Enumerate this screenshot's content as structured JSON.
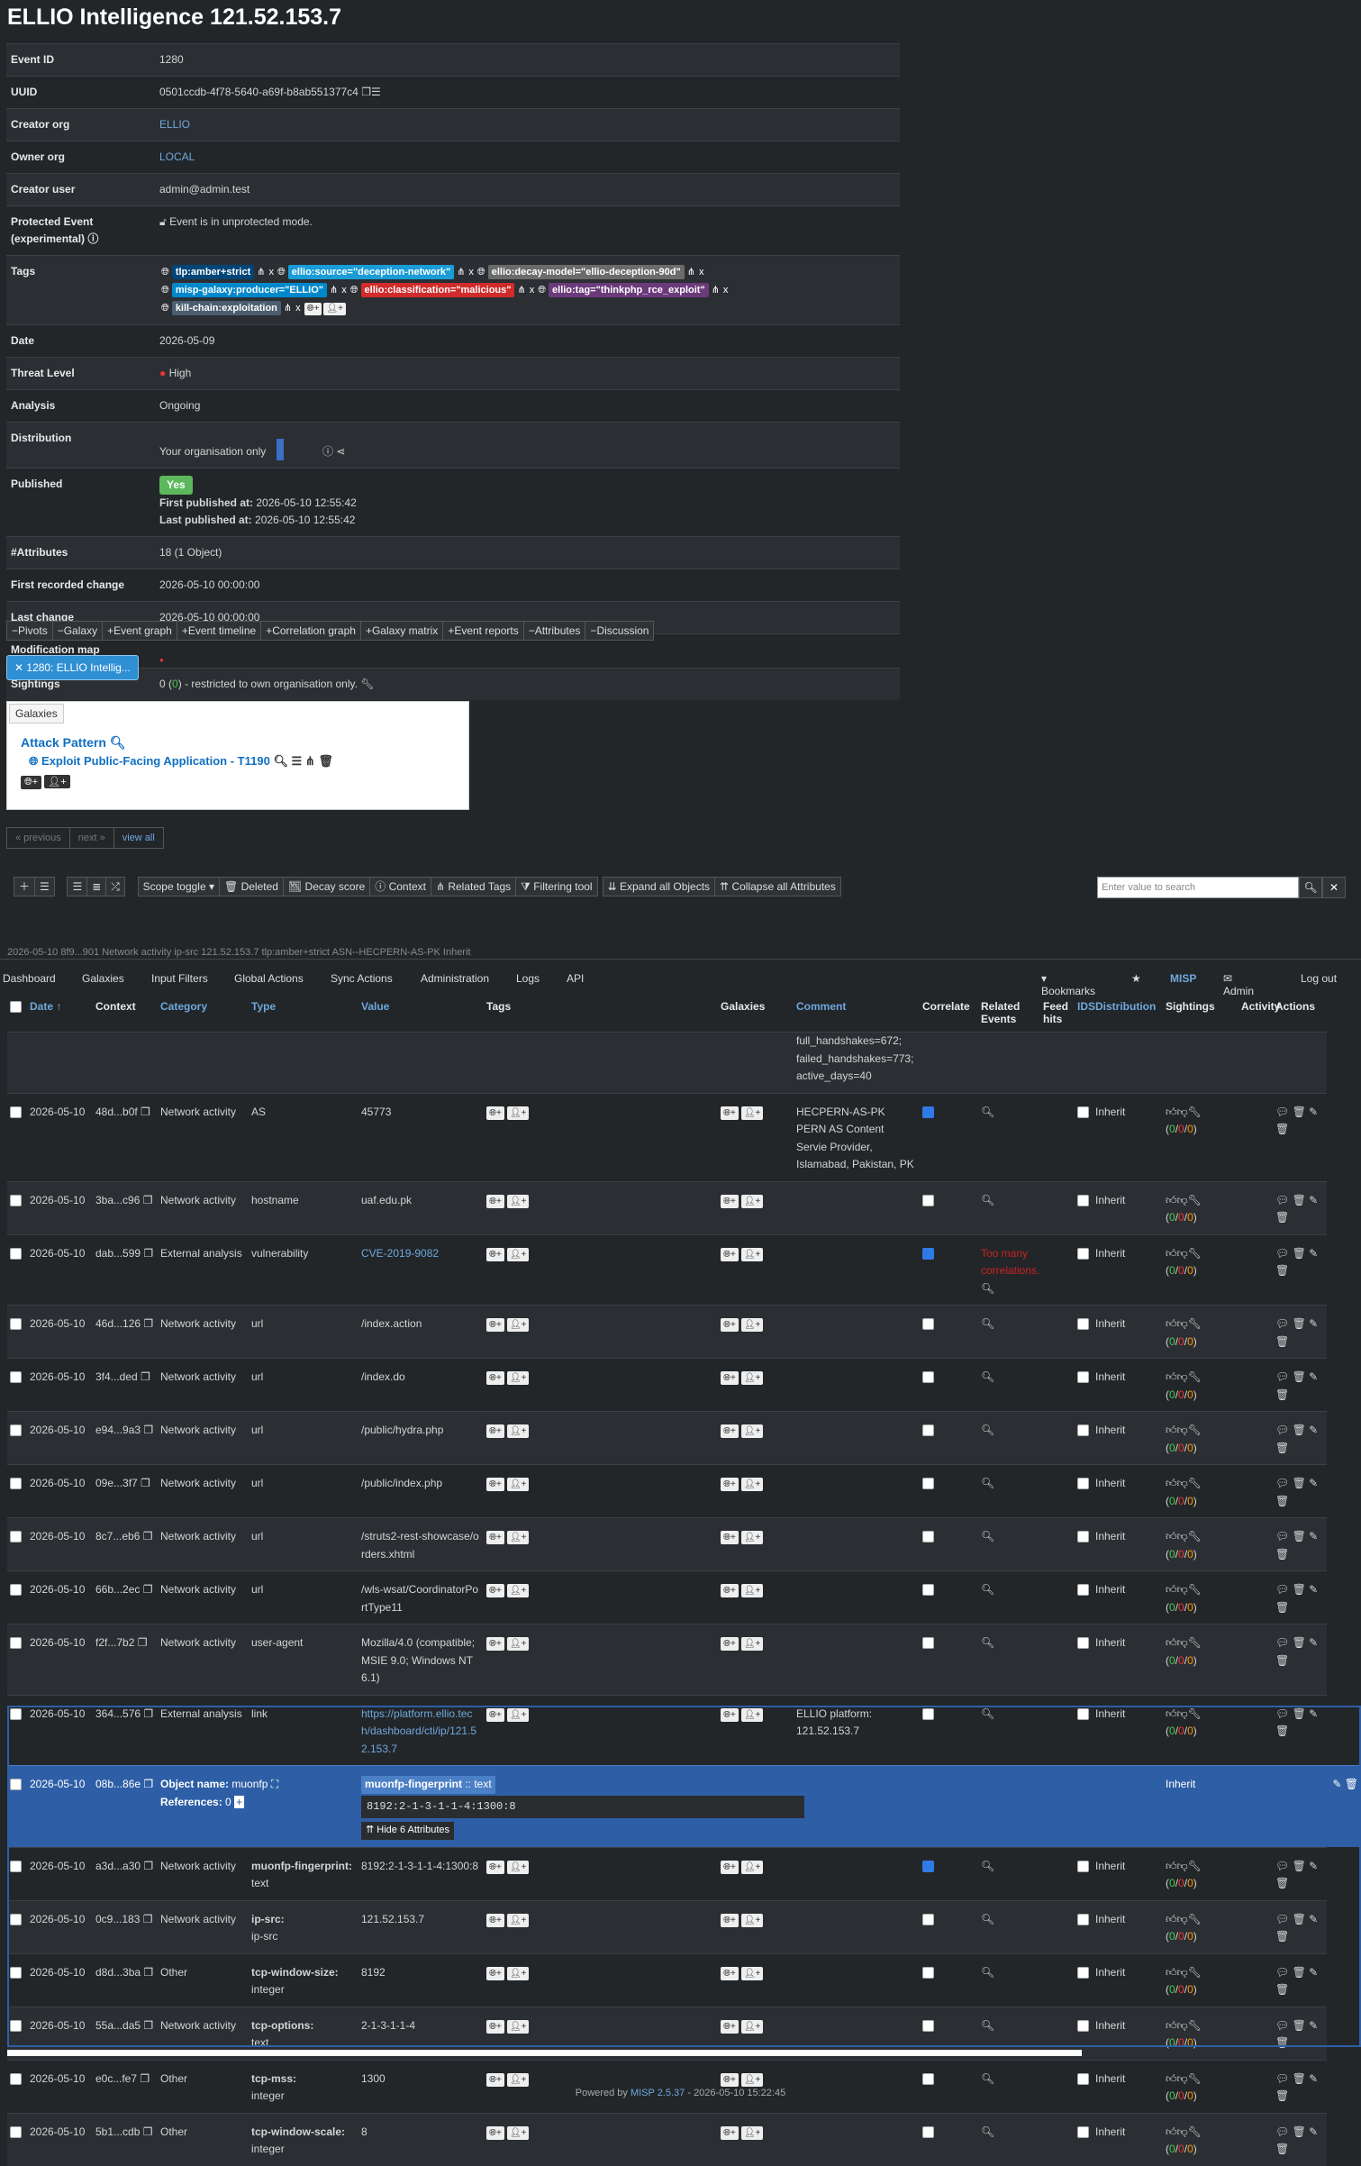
{
  "title": "ELLIO Intelligence 121.52.153.7",
  "details": {
    "event_id_l": "Event ID",
    "event_id": "1280",
    "uuid_l": "UUID",
    "uuid": "0501ccdb-4f78-5640-a69f-b8ab551377c4",
    "creator_org_l": "Creator org",
    "creator_org": "ELLIO",
    "owner_org_l": "Owner org",
    "owner_org": "LOCAL",
    "creator_user_l": "Creator user",
    "creator_user": "admin@admin.test",
    "protected_l": "Protected Event (experimental)",
    "protected": "Event is in unprotected mode.",
    "tags_l": "Tags",
    "tags": [
      "tlp:amber+strict",
      "ellio:source=\"deception-network\"",
      "ellio:decay-model=\"ellio-deception-90d\"",
      "misp-galaxy:producer=\"ELLIO\"",
      "ellio:classification=\"malicious\"",
      "ellio:tag=\"thinkphp_rce_exploit\"",
      "kill-chain:exploitation"
    ],
    "tag_colors": [
      "#004577",
      "#1a9cd7",
      "#6b6b6b",
      "#0088cc",
      "#d12b2b",
      "#6b3a7a",
      "#4b5e70"
    ],
    "date_l": "Date",
    "date": "2026-05-09",
    "threat_l": "Threat Level",
    "threat": "High",
    "analysis_l": "Analysis",
    "analysis": "Ongoing",
    "distribution_l": "Distribution",
    "distribution": "Your organisation only",
    "published_l": "Published",
    "published": "Yes",
    "first_pub_l": "First published at:",
    "first_pub": "2026-05-10 12:55:42",
    "last_pub_l": "Last published at:",
    "last_pub": "2026-05-10 12:55:42",
    "attrs_l": "#Attributes",
    "attrs": "18 (1 Object)",
    "first_change_l": "First recorded change",
    "first_change": "2026-05-10 00:00:00",
    "last_change_l": "Last change",
    "last_change": "2026-05-10 00:00:00",
    "modmap_l": "Modification map",
    "sightings_l": "Sightings",
    "sightings_zero": "0",
    "sightings_inner": "0",
    "sightings_text": "- restricted to own organisation only."
  },
  "toggles": [
    "Pivots",
    "Galaxy",
    "Event graph",
    "Event timeline",
    "Correlation graph",
    "Galaxy matrix",
    "Event reports",
    "Attributes",
    "Discussion"
  ],
  "event_tab": "1280: ELLIO Intellig...",
  "galaxy": {
    "header": "Galaxies",
    "cluster": "Attack Pattern",
    "item": "Exploit Public-Facing Application - T1190"
  },
  "pager": {
    "prev": "« previous",
    "next": "next »",
    "all": "view all"
  },
  "list_toolbar": [
    "Scope toggle",
    "Deleted",
    "Decay score",
    "Context",
    "Related Tags",
    "Filtering tool",
    "Expand all Objects",
    "Collapse all Attributes"
  ],
  "search_placeholder": "Enter value to search",
  "hidden_row": "2026-05-10  8f9...901  Network activity  ip-src  121.52.153.7  tlp:amber+strict  ASN--HECPERN-AS-PK  Inherit",
  "nav": {
    "dashboard": "Dashboard",
    "galaxies": "Galaxies",
    "input_filters": "Input Filters",
    "global_actions": "Global Actions",
    "sync_actions": "Sync Actions",
    "administration": "Administration",
    "logs": "Logs",
    "api": "API",
    "bookmarks": "Bookmarks",
    "misp": "MISP",
    "admin": "Admin",
    "logout": "Log out"
  },
  "cols": {
    "date": "Date",
    "context": "Context",
    "category": "Category",
    "type": "Type",
    "value": "Value",
    "tags": "Tags",
    "galaxies": "Galaxies",
    "comment": "Comment",
    "correlate": "Correlate",
    "related": "Related Events",
    "feed": "Feed hits",
    "ids": "IDS",
    "distribution": "Distribution",
    "sightings": "Sightings",
    "activity": "Activity",
    "actions": "Actions"
  },
  "partial_comment": "full_handshakes=672; failed_handshakes=773; active_days=40",
  "rows": [
    {
      "date": "2026-05-10",
      "ctx": "48d...b0f",
      "cat": "Network activity",
      "type": "AS",
      "value": "45773",
      "comment": "HECPERN-AS-PK PERN AS Content Servie Provider, Islamabad, Pakistan, PK",
      "corr": true,
      "rel": "",
      "dist": "Inherit"
    },
    {
      "date": "2026-05-10",
      "ctx": "3ba...c96",
      "cat": "Network activity",
      "type": "hostname",
      "value": "uaf.edu.pk",
      "comment": "",
      "corr": false,
      "rel": "",
      "dist": "Inherit"
    },
    {
      "date": "2026-05-10",
      "ctx": "dab...599",
      "cat": "External analysis",
      "type": "vulnerability",
      "value": "CVE-2019-9082",
      "comment": "",
      "corr": true,
      "rel": "Too many correlations.",
      "dist": "Inherit",
      "link": true
    },
    {
      "date": "2026-05-10",
      "ctx": "46d...126",
      "cat": "Network activity",
      "type": "url",
      "value": "/index.action",
      "comment": "",
      "corr": false,
      "rel": "",
      "dist": "Inherit"
    },
    {
      "date": "2026-05-10",
      "ctx": "3f4...ded",
      "cat": "Network activity",
      "type": "url",
      "value": "/index.do",
      "comment": "",
      "corr": false,
      "rel": "",
      "dist": "Inherit"
    },
    {
      "date": "2026-05-10",
      "ctx": "e94...9a3",
      "cat": "Network activity",
      "type": "url",
      "value": "/public/hydra.php",
      "comment": "",
      "corr": false,
      "rel": "",
      "dist": "Inherit"
    },
    {
      "date": "2026-05-10",
      "ctx": "09e...3f7",
      "cat": "Network activity",
      "type": "url",
      "value": "/public/index.php",
      "comment": "",
      "corr": false,
      "rel": "",
      "dist": "Inherit"
    },
    {
      "date": "2026-05-10",
      "ctx": "8c7...eb6",
      "cat": "Network activity",
      "type": "url",
      "value": "/struts2-rest-showcase/orders.xhtml",
      "comment": "",
      "corr": false,
      "rel": "",
      "dist": "Inherit"
    },
    {
      "date": "2026-05-10",
      "ctx": "66b...2ec",
      "cat": "Network activity",
      "type": "url",
      "value": "/wls-wsat/CoordinatorPortType11",
      "comment": "",
      "corr": false,
      "rel": "",
      "dist": "Inherit"
    },
    {
      "date": "2026-05-10",
      "ctx": "f2f...7b2",
      "cat": "Network activity",
      "type": "user-agent",
      "value": "Mozilla/4.0 (compatible; MSIE 9.0; Windows NT 6.1)",
      "comment": "",
      "corr": false,
      "rel": "",
      "dist": "Inherit"
    },
    {
      "date": "2026-05-10",
      "ctx": "364...576",
      "cat": "External analysis",
      "type": "link",
      "value": "https://platform.ellio.tech/dashboard/cti/ip/121.52.153.7",
      "comment": "ELLIO platform: 121.52.153.7",
      "corr": false,
      "rel": "",
      "dist": "Inherit",
      "link": true
    }
  ],
  "object": {
    "date": "2026-05-10",
    "ctx": "08b...86e",
    "name_l": "Object name:",
    "name": "muonfp",
    "refs_l": "References:",
    "refs": "0",
    "attr_label": "muonfp-fingerprint",
    "attr_type": ":: text",
    "attr_value": "8192:2-1-3-1-1-4:1300:8",
    "hide": "Hide 6 Attributes",
    "dist": "Inherit"
  },
  "obj_rows": [
    {
      "date": "2026-05-10",
      "ctx": "a3d...a30",
      "cat": "Network activity",
      "rel": "muonfp-fingerprint:",
      "type": "text",
      "value": "8192:2-1-3-1-1-4:1300:8",
      "corr": true,
      "dist": "Inherit"
    },
    {
      "date": "2026-05-10",
      "ctx": "0c9...183",
      "cat": "Network activity",
      "rel": "ip-src:",
      "type": "ip-src",
      "value": "121.52.153.7",
      "corr": false,
      "dist": "Inherit"
    },
    {
      "date": "2026-05-10",
      "ctx": "d8d...3ba",
      "cat": "Other",
      "rel": "tcp-window-size:",
      "type": "integer",
      "value": "8192",
      "corr": false,
      "dist": "Inherit"
    },
    {
      "date": "2026-05-10",
      "ctx": "55a...da5",
      "cat": "Network activity",
      "rel": "tcp-options:",
      "type": "text",
      "value": "2-1-3-1-1-4",
      "corr": false,
      "dist": "Inherit"
    },
    {
      "date": "2026-05-10",
      "ctx": "e0c...fe7",
      "cat": "Other",
      "rel": "tcp-mss:",
      "type": "integer",
      "value": "1300",
      "corr": false,
      "dist": "Inherit"
    },
    {
      "date": "2026-05-10",
      "ctx": "5b1...cdb",
      "cat": "Other",
      "rel": "tcp-window-scale:",
      "type": "integer",
      "value": "8",
      "corr": false,
      "dist": "Inherit"
    }
  ],
  "footer": {
    "pre": "Powered by",
    "link": "MISP 2.5.37",
    "post": "- 2026-05-10 15:22:45"
  }
}
